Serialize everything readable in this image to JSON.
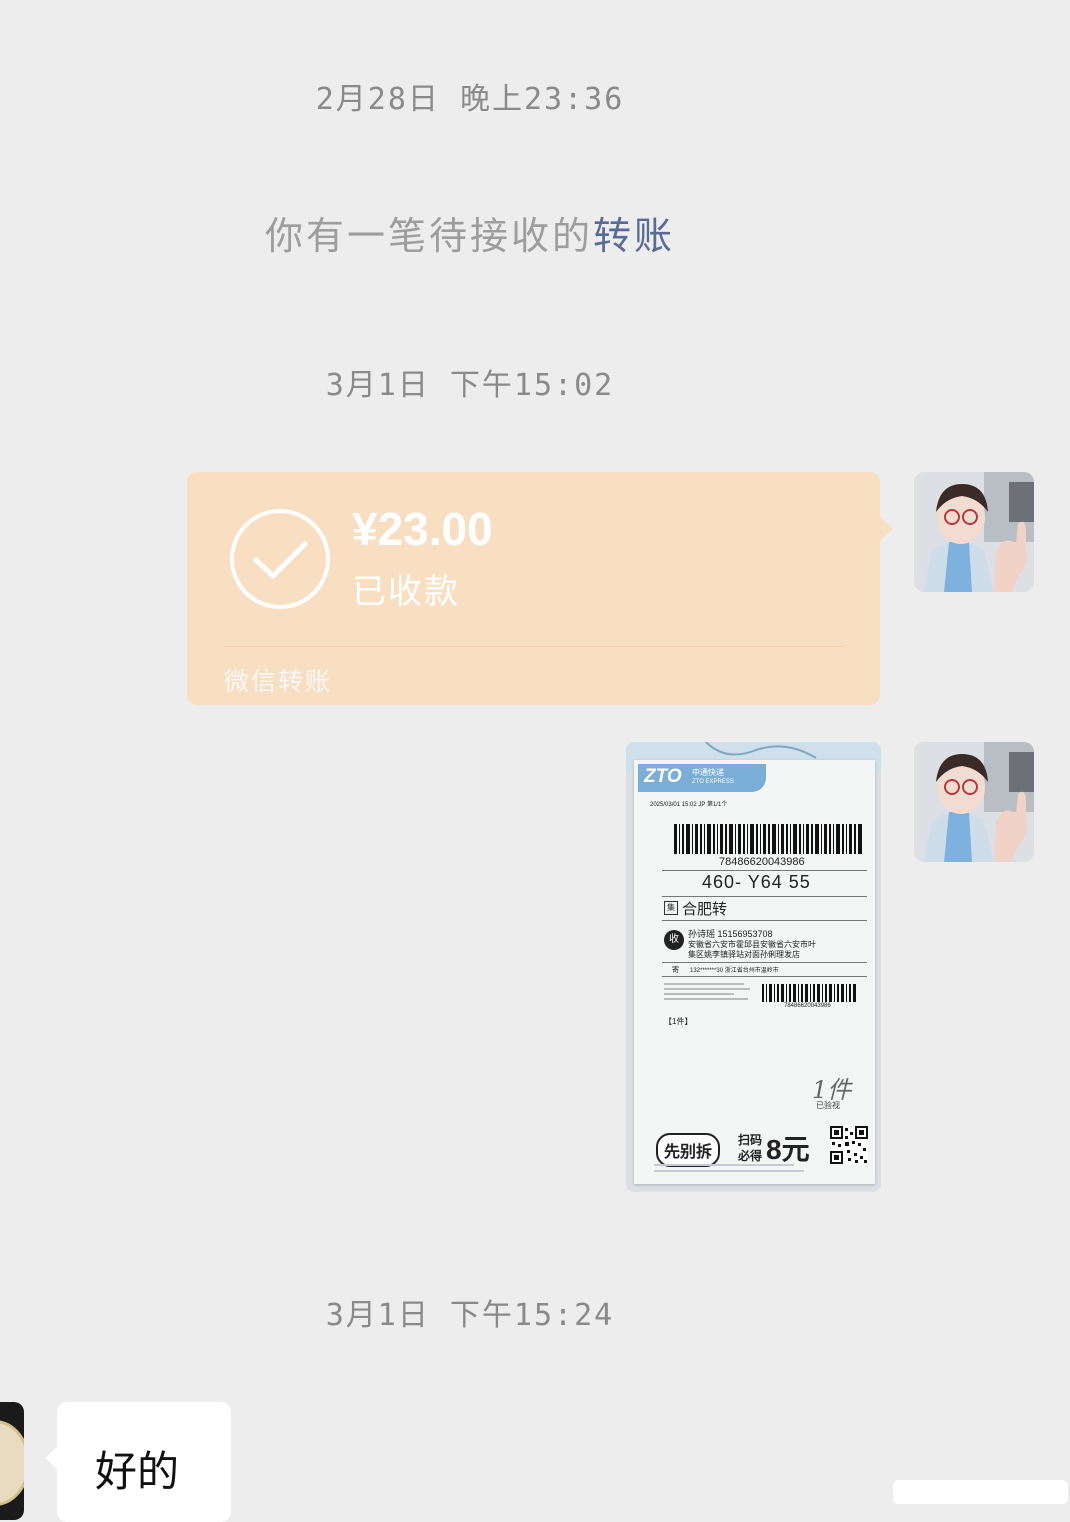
{
  "timestamps": [
    "2月28日 晚上23:36",
    "3月1日 下午15:02",
    "3月1日 下午15:24"
  ],
  "system_message": {
    "prefix": "你有一笔待接收的",
    "link": "转账"
  },
  "transfer": {
    "amount": "¥23.00",
    "status": "已收款",
    "footer": "微信转账",
    "color": "#f9dfc2"
  },
  "parcel_label": {
    "carrier": "ZTO",
    "carrier_cn": "中通快递",
    "carrier_en": "ZTO EXPRESS",
    "print_info": "2025/03/01 15:02 JP 第1/1个",
    "tracking_number": "78486620043986",
    "sort_code": "460- Y64 55",
    "route_badge": "集",
    "route": "合肥转",
    "receive_badge": "收",
    "recipient": "孙诗瑶 15156953708",
    "address_line1": "安徽省六安市霍邱县安徽省六安市叶",
    "address_line2": "集区姚李镇驿站对面孙俐理发店",
    "sender_badge": "寄",
    "sender": "132*******30  浙江省台州市温岭市",
    "small_barcode_number": "78486620043986",
    "piece_count": "【1件】",
    "handwritten": "1件",
    "checked_stamp": "已验视",
    "promo_left": "先别拆",
    "promo_right_top": "扫码",
    "promo_right_bottom": "必得",
    "promo_amount": "8元"
  },
  "reply": {
    "text": "好的"
  }
}
